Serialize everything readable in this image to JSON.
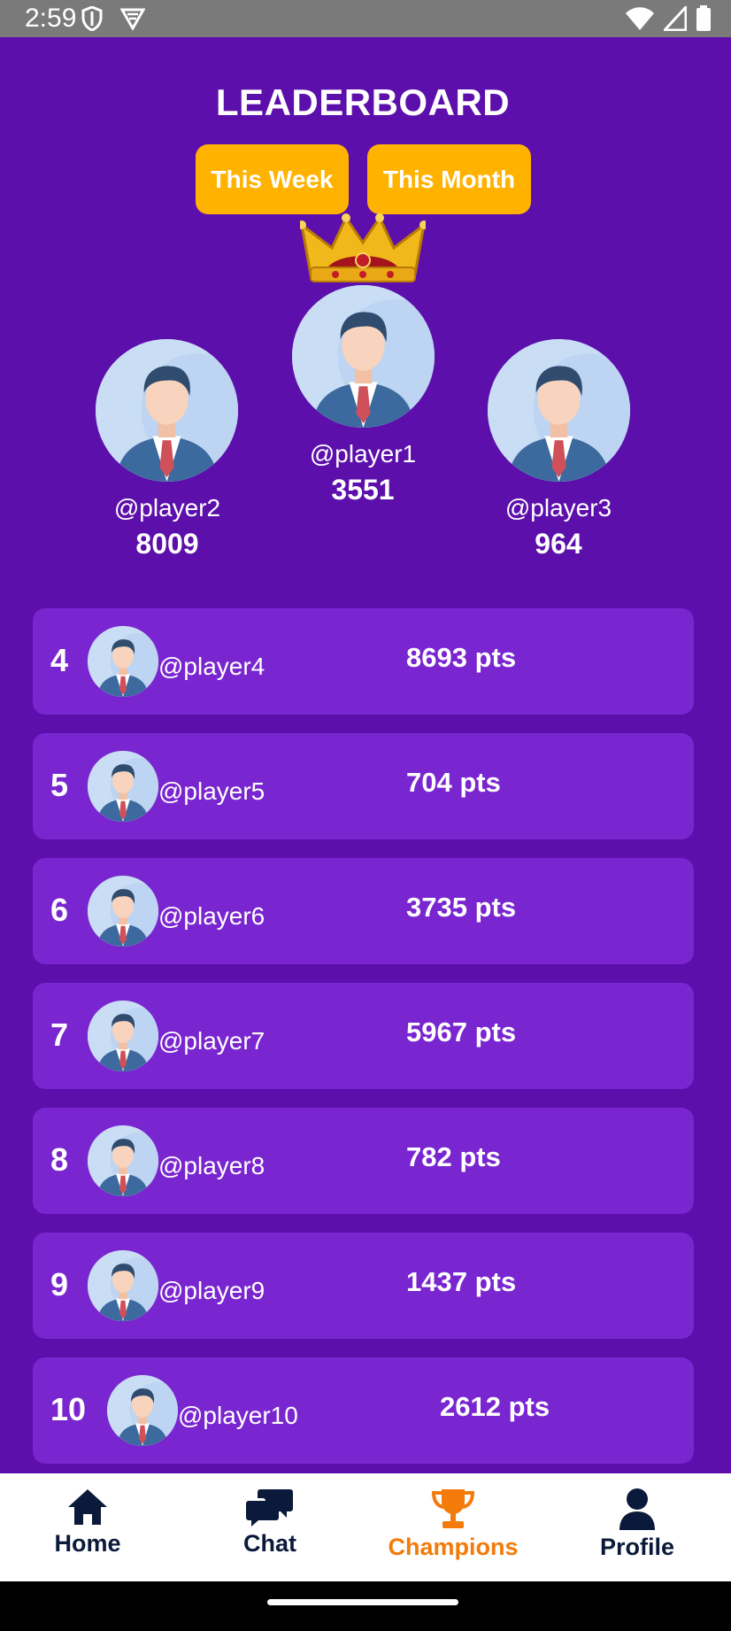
{
  "status_bar": {
    "time": "2:59",
    "icons": [
      "shield-icon",
      "vpn-icon",
      "wifi-icon",
      "signal-icon",
      "battery-icon"
    ]
  },
  "header": {
    "title": "LEADERBOARD"
  },
  "filters": {
    "this_week": "This Week",
    "this_month": "This Month"
  },
  "podium": {
    "first": {
      "handle": "@player1",
      "score": "3551"
    },
    "second": {
      "handle": "@player2",
      "score": "8009"
    },
    "third": {
      "handle": "@player3",
      "score": "964"
    }
  },
  "rankings": [
    {
      "rank": "4",
      "handle": "@player4",
      "points": "8693 pts"
    },
    {
      "rank": "5",
      "handle": "@player5",
      "points": "704 pts"
    },
    {
      "rank": "6",
      "handle": "@player6",
      "points": "3735 pts"
    },
    {
      "rank": "7",
      "handle": "@player7",
      "points": "5967 pts"
    },
    {
      "rank": "8",
      "handle": "@player8",
      "points": "782 pts"
    },
    {
      "rank": "9",
      "handle": "@player9",
      "points": "1437 pts"
    },
    {
      "rank": "10",
      "handle": "@player10",
      "points": "2612 pts"
    }
  ],
  "bottom_nav": {
    "home": "Home",
    "chat": "Chat",
    "champions": "Champions",
    "profile": "Profile",
    "active": "Champions"
  },
  "colors": {
    "background": "#5c0fab",
    "row": "#7a26d0",
    "accent_button": "#ffb300",
    "active_nav": "#f47a0a",
    "nav_text": "#0b1a3b"
  }
}
